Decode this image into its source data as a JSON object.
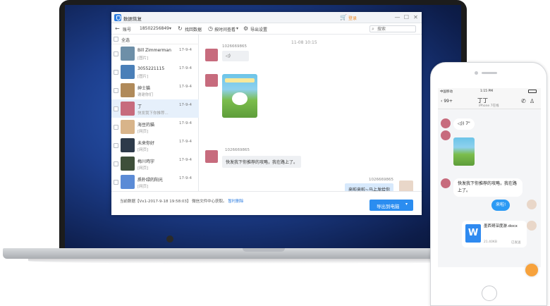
{
  "app": {
    "title": "数据恢复",
    "upgrade_label": "登录",
    "window_buttons": [
      "—",
      "☐",
      "✕"
    ]
  },
  "toolbar": {
    "account_label": "账号",
    "account_value": "18502256849",
    "items": [
      "找回数据",
      "按时间查看",
      "导出设置"
    ],
    "search_placeholder": "搜索"
  },
  "sidebar": {
    "select_all": "全选",
    "contacts": [
      {
        "name": "Bill Zimmerman",
        "sub": "[图片]",
        "date": "17-9-4",
        "color": "#6d8fa8"
      },
      {
        "name": "3055221115",
        "sub": "[图片]",
        "date": "17-9-4",
        "color": "#4a7fb8"
      },
      {
        "name": "绅士猫",
        "sub": "谢谢你们",
        "date": "17-9-4",
        "color": "#b08a5a"
      },
      {
        "name": "丁",
        "sub": "快发我下你推荐...",
        "date": "17-9-4",
        "color": "#c76b7d"
      },
      {
        "name": "海豆的猫",
        "sub": "[网页]",
        "date": "17-9-4",
        "color": "#d8b48a"
      },
      {
        "name": "未来你好",
        "sub": "[网页]",
        "date": "17-9-4",
        "color": "#2d3a4a"
      },
      {
        "name": "梅川鸡宇",
        "sub": "[网页]",
        "date": "17-9-4",
        "color": "#3e4f3a"
      },
      {
        "name": "质朴绿的阳光",
        "sub": "[网页]",
        "date": "17-9-4",
        "color": "#5b8bd6"
      }
    ]
  },
  "chat": {
    "timestamp": "11-08 10:15",
    "messages": [
      {
        "sender": "1026669865",
        "text": "◁)"
      },
      {
        "sender": "",
        "text": ""
      },
      {
        "sender": "1026669865",
        "text": "快发我下你推荐的攻略，我在路上了。"
      },
      {
        "sender": "1026669865",
        "text": "来啦来啦~马上发给你"
      }
    ]
  },
  "statusbar": {
    "text": "当前数据【Vx1-2017-9-18 19:58:03】 微信文件中心获取。",
    "link": "暂时删除",
    "export_label": "导出到电脑",
    "export_dropdown": "▾"
  },
  "phone": {
    "status_left": "中国移动",
    "status_time": "1:15 PM",
    "status_right": "",
    "back_label": "99+",
    "title": "丁丁",
    "subtitle": "iPhone 7在线",
    "messages": [
      {
        "text": "◁)) 7\""
      },
      {
        "text": "快发我下你推荐的攻略，我在路上了。"
      },
      {
        "text": "来啦!"
      }
    ],
    "file": {
      "icon_letter": "W",
      "name": "墨西哥深度游.docx",
      "size": "21.40KB",
      "status": "已发送"
    }
  },
  "colors": {
    "accent": "#2b8df0",
    "upgrade": "#f08a24",
    "bubble_me": "#d7e9fc"
  }
}
